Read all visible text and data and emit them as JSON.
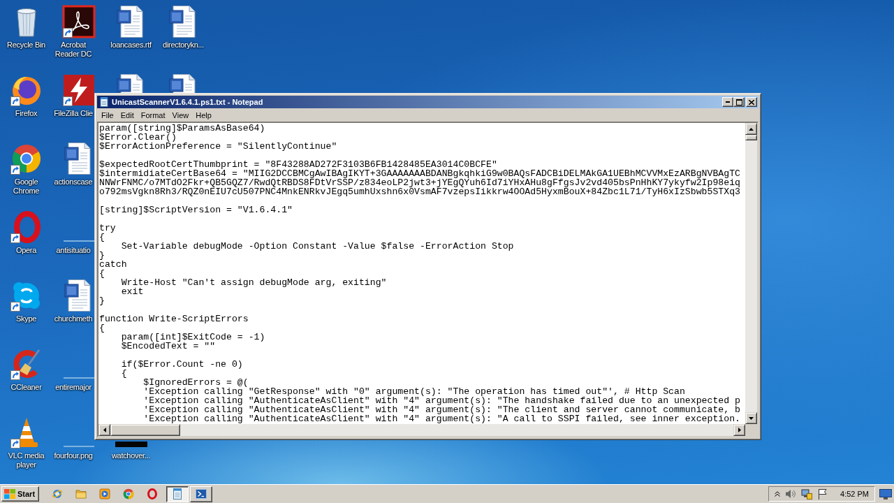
{
  "desktop": {
    "columns": [
      {
        "top": [
          {
            "kind": "recycle-bin",
            "label": "Recycle Bin",
            "shortcut": false,
            "covered": false
          },
          {
            "kind": "firefox",
            "label": "Firefox",
            "shortcut": true,
            "covered": false
          },
          {
            "kind": "chrome",
            "label": "Google Chrome",
            "shortcut": true,
            "covered": false
          },
          {
            "kind": "opera",
            "label": "Opera",
            "shortcut": true,
            "covered": false
          },
          {
            "kind": "skype",
            "label": "Skype",
            "shortcut": true,
            "covered": false
          },
          {
            "kind": "ccleaner",
            "label": "CCleaner",
            "shortcut": true,
            "covered": false
          },
          {
            "kind": "vlc",
            "label": "VLC media player",
            "shortcut": true,
            "covered": false
          }
        ]
      },
      {
        "top": [
          {
            "kind": "acrobat",
            "label": "Acrobat Reader DC",
            "shortcut": true,
            "covered": false
          },
          {
            "kind": "filezilla",
            "label": "FileZilla Clie",
            "shortcut": true,
            "covered": false
          },
          {
            "kind": "document",
            "label": "actionscase",
            "shortcut": false,
            "covered": false
          },
          {
            "kind": "blank",
            "label": "antisituatio"
          },
          {
            "kind": "document",
            "label": "churchmeth",
            "shortcut": false,
            "covered": false
          },
          {
            "kind": "blank",
            "label": "entiremajor"
          },
          {
            "kind": "blank",
            "label": "fourfour.png"
          }
        ]
      },
      {
        "top": [
          {
            "kind": "document",
            "label": "loancases.rtf",
            "shortcut": false,
            "covered": false
          },
          {
            "kind": "document",
            "covered": true
          }
        ],
        "bottom": [
          {
            "kind": "image",
            "label": "watchover...",
            "covered": true
          }
        ]
      },
      {
        "top": [
          {
            "kind": "document",
            "label": "directorykn...",
            "shortcut": false,
            "covered": false
          },
          {
            "kind": "document",
            "covered": true
          }
        ]
      }
    ]
  },
  "window": {
    "title": "UnicastScannerV1.6.4.1.ps1.txt - Notepad",
    "menu": [
      "File",
      "Edit",
      "Format",
      "View",
      "Help"
    ],
    "text_blocks": [
      [
        "param([string]$ParamsAsBase64)",
        "$Error.Clear()",
        "$ErrorActionPreference = \"SilentlyContinue\""
      ],
      [
        "$expectedRootCertThumbprint = \"8F43288AD272F3103B6FB1428485EA3014C0BCFE\"",
        "$intermidiateCertBase64 = \"MIIG2DCCBMCgAwIBAgIKYT+3GAAAAAAABDANBgkqhkiG9w0BAQsFADCBiDELMAkGA1UEBhMCVVMxEzARBgNVBAgTC",
        "NNWrFNMC/o7MTdO2Fkr+QB5GQZ7/RwdQtRBDS8FDtVrSSP/z834eoLP2jwt3+jYEgQYuh6Id7iYHxAHu8gFfgsJv2vd405bsPnHhKY7ykyfw2Ip98eiq",
        "o792msVgkn8Rh3/RQZ0nEIU7cU507PNC4MnkENRkvJEgq5umhUxshn6x0VsmAF7vzepsIikkrw4OOAd5HyxmBouX+84Zbc1L71/TyH6xIzSbwb5STXq3"
      ],
      [
        "[string]$ScriptVersion = \"V1.6.4.1\""
      ],
      [
        "try",
        "{",
        "    Set-Variable debugMode -Option Constant -Value $false -ErrorAction Stop",
        "}",
        "catch",
        "{",
        "    Write-Host \"Can't assign debugMode arg, exiting\"",
        "    exit",
        "}"
      ],
      [
        "function Write-ScriptErrors",
        "{",
        "    param([int]$ExitCode = -1)",
        "    $EncodedText = \"\""
      ],
      [
        "    if($Error.Count -ne 0)",
        "    {",
        "        $IgnoredErrors = @(",
        "        'Exception calling \"GetResponse\" with \"0\" argument(s): \"The operation has timed out\"', # Http Scan",
        "        'Exception calling \"AuthenticateAsClient\" with \"4\" argument(s): \"The handshake failed due to an unexpected p",
        "        'Exception calling \"AuthenticateAsClient\" with \"4\" argument(s): \"The client and server cannot communicate, b",
        "        'Exception calling \"AuthenticateAsClient\" with \"4\" argument(s): \"A call to SSPI failed, see inner exception."
      ]
    ]
  },
  "taskbar": {
    "start": "Start",
    "tasks": [
      {
        "kind": "notepad",
        "selected": true
      },
      {
        "kind": "powershell",
        "selected": false
      }
    ],
    "clock": "4:52 PM"
  }
}
